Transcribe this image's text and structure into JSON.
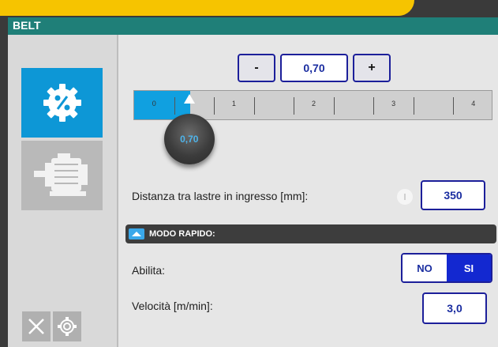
{
  "window": {
    "title": "BELT"
  },
  "sidebar": {
    "items": [
      {
        "icon": "speed-percent-gear-icon",
        "active": true
      },
      {
        "icon": "motor-icon",
        "active": false
      }
    ],
    "bottom": {
      "close_icon": "close-icon",
      "settings_icon": "settings-gear-icon"
    }
  },
  "speed_adjust": {
    "minus_label": "-",
    "plus_label": "+",
    "value": "0,70",
    "slider": {
      "min": 0,
      "max": 4.5,
      "value": 0.7,
      "tick_labels": [
        "0",
        "1",
        "2",
        "3",
        "4"
      ],
      "knob_label": "0,70"
    }
  },
  "distance": {
    "label": "Distanza tra lastre in ingresso [mm]:",
    "info_icon": "info-icon",
    "value": "350"
  },
  "fast_mode": {
    "section_title": "MODO RAPIDO:",
    "section_icon": "fast-mode-icon",
    "enable_label": "Abilita:",
    "toggle": {
      "no_label": "NO",
      "si_label": "SI",
      "selected": "SI"
    },
    "speed_label": "Velocità [m/min]:",
    "speed_value": "3,0"
  },
  "colors": {
    "accent": "#0d97d6",
    "field_border": "#1c1f9a",
    "toggle_active": "#1328d0",
    "banner": "#f6c400",
    "titlebar": "#1f7f78"
  }
}
